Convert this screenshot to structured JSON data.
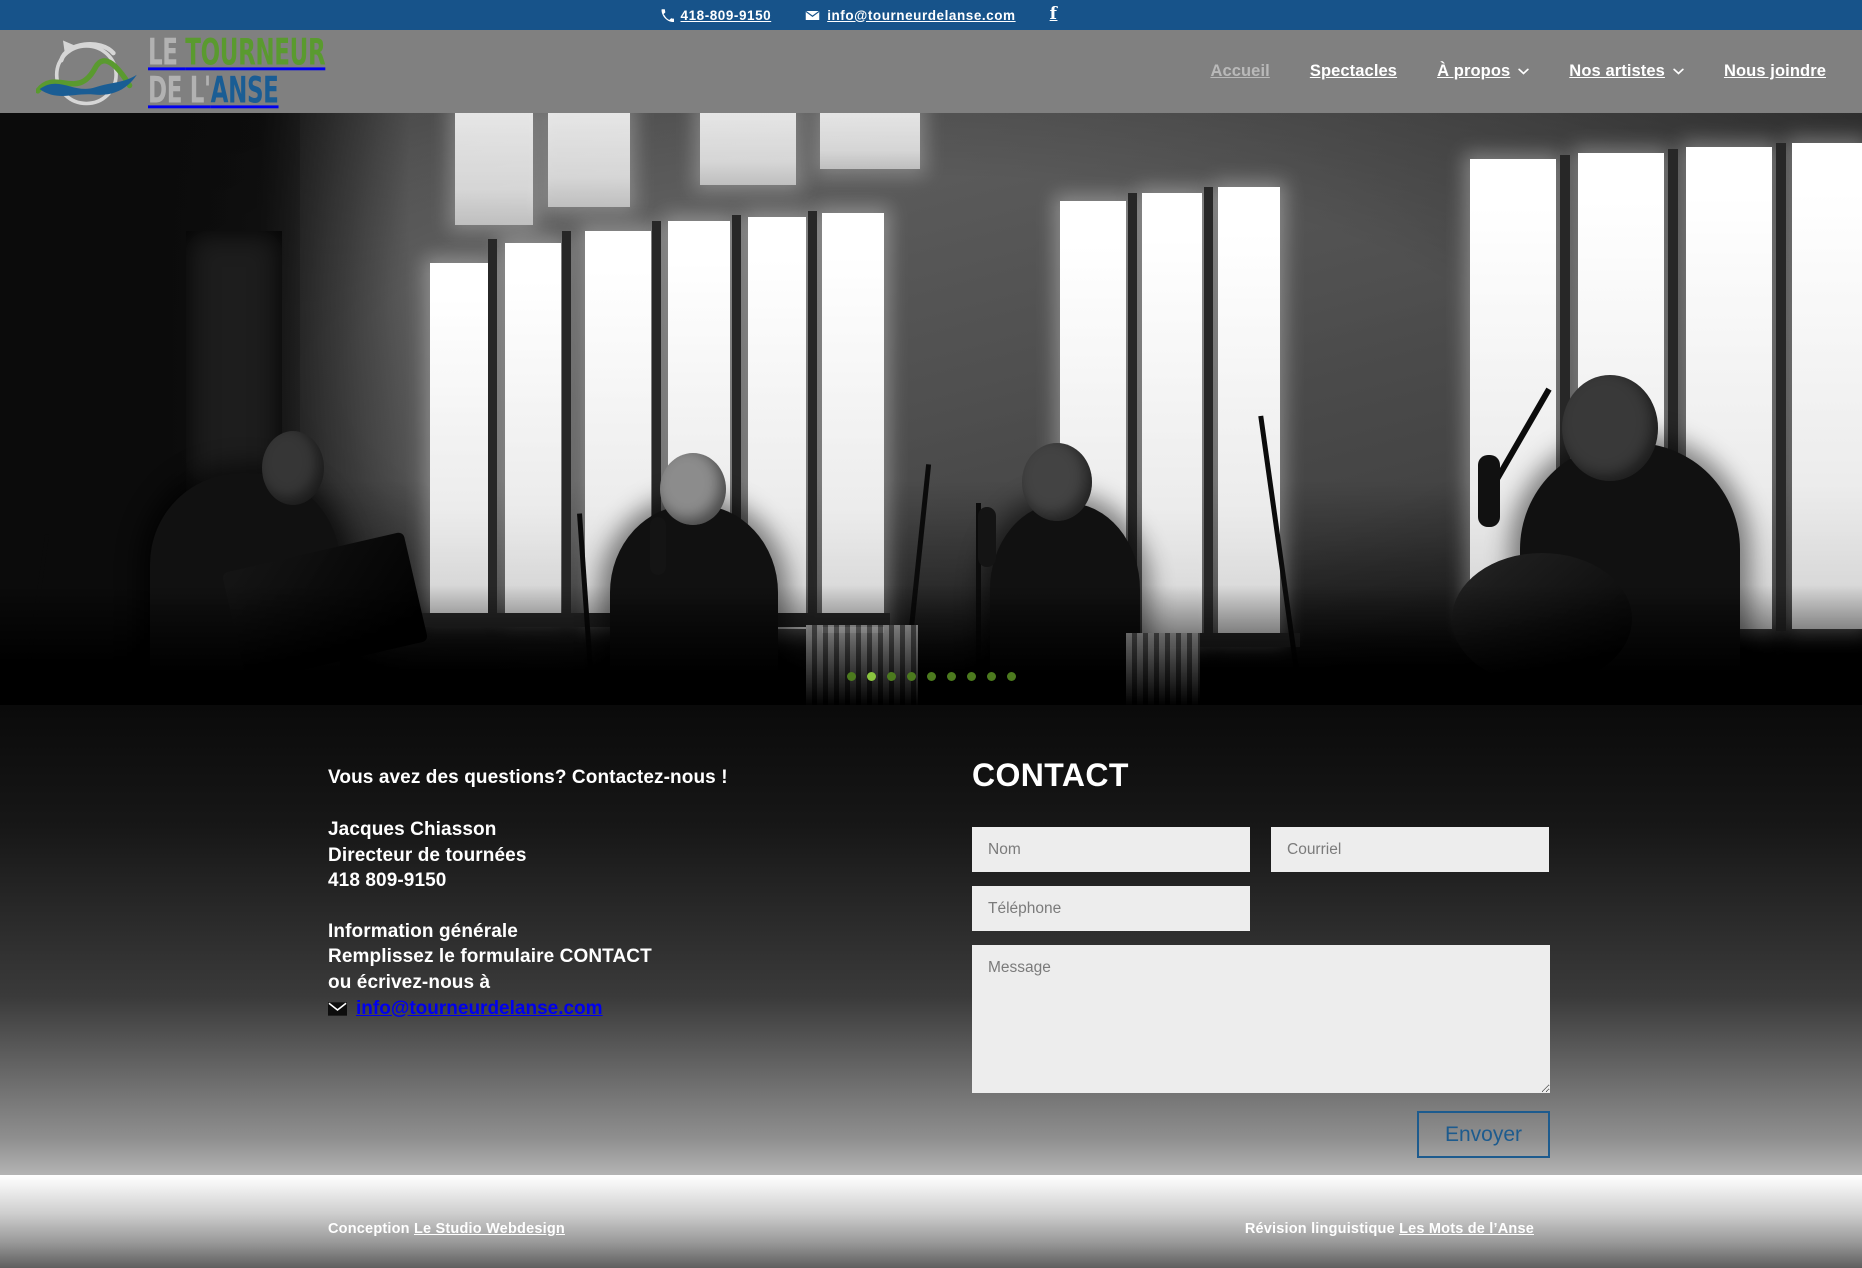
{
  "topbar": {
    "phone": "418-809-9150",
    "email": "info@tourneurdelanse.com",
    "phone_icon": "phone-icon",
    "email_icon": "envelope-icon",
    "facebook_icon": "facebook-icon",
    "facebook_label": "f",
    "background": "#17538a"
  },
  "header": {
    "background": "#808080",
    "logo": {
      "line1_part1": "LE ",
      "line1_part2": "TOURNEUR",
      "line2_part1": "DE L'",
      "line2_part2": "ANSE",
      "alt": "Le Tourneur de l'Anse",
      "color_gray": "#b2b2b2",
      "color_green": "#5a9a2f",
      "color_blue": "#1a5d94"
    },
    "nav": [
      {
        "label": "Accueil",
        "active": true,
        "has_caret": false
      },
      {
        "label": "Spectacles",
        "active": false,
        "has_caret": false
      },
      {
        "label": "À propos",
        "active": false,
        "has_caret": true
      },
      {
        "label": "Nos artistes",
        "active": false,
        "has_caret": true
      },
      {
        "label": "Nous joindre",
        "active": false,
        "has_caret": false
      }
    ],
    "caret_glyph": "❯"
  },
  "hero": {
    "image_description": "Quatre musiciens assis jouant accordéon et guitare devant de grandes fenêtres, photo noir et blanc",
    "slide_count": 9,
    "active_slide": 2,
    "dot_color": "#4c7a1e",
    "dot_active_color": "#8ac43f"
  },
  "contact": {
    "left": {
      "title": "Vous avez des questions? Contactez-nous !",
      "name": "Jacques Chiasson",
      "role": "Directeur de tournées",
      "phone": "418 809-9150",
      "info_title": "Information générale",
      "info_line1": "Remplissez le formulaire CONTACT",
      "info_line2": "ou écrivez-nous à",
      "email": "info@tourneurdelanse.com",
      "email_icon": "envelope-icon"
    },
    "form": {
      "title": "CONTACT",
      "fields": [
        {
          "name": "nom",
          "placeholder": "Nom",
          "value": ""
        },
        {
          "name": "courriel",
          "placeholder": "Courriel",
          "value": ""
        },
        {
          "name": "telephone",
          "placeholder": "Téléphone",
          "value": ""
        },
        {
          "name": "message",
          "placeholder": "Message",
          "value": ""
        }
      ],
      "submit_label": "Envoyer",
      "submit_color": "#1d5b8e"
    }
  },
  "footer": {
    "left_prefix": "Conception ",
    "left_link": "Le Studio Webdesign",
    "right_prefix": "Révision linguistique ",
    "right_link": "Les Mots de l’Anse"
  }
}
